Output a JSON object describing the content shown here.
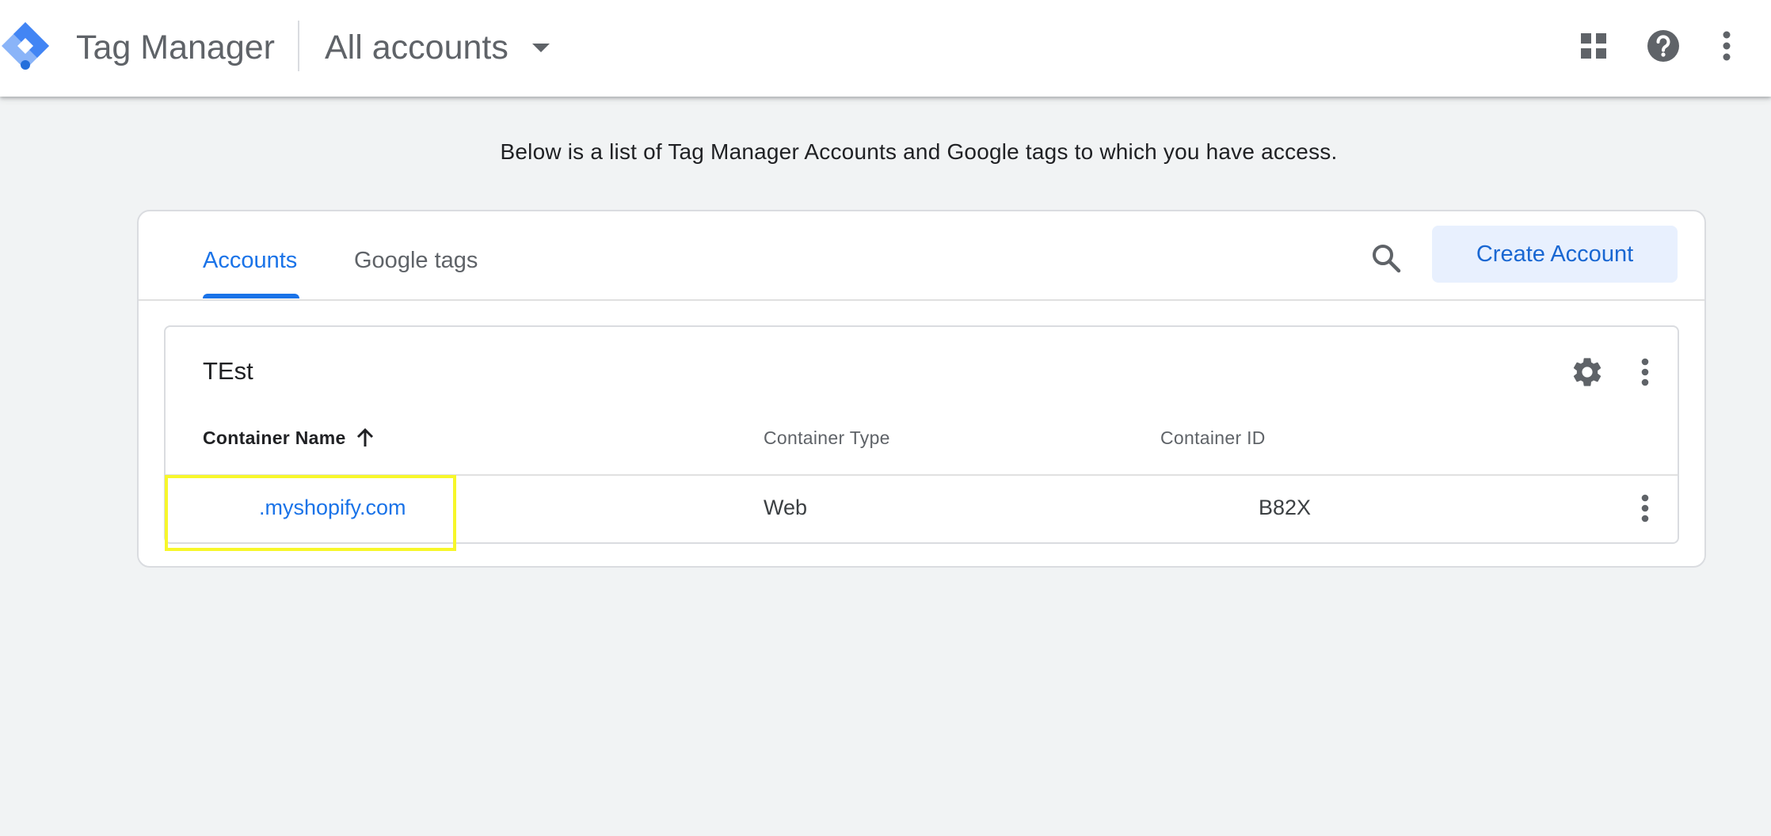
{
  "header": {
    "product_name": "Tag Manager",
    "account_switcher_label": "All accounts",
    "icons": [
      "tag-manager-logo",
      "apps-icon",
      "help-icon",
      "more-vert-icon"
    ]
  },
  "intro_text": "Below is a list of Tag Manager Accounts and Google tags to which you have access.",
  "tabs": [
    {
      "label": "Accounts",
      "active": true
    },
    {
      "label": "Google tags",
      "active": false
    }
  ],
  "toolbar": {
    "create_label": "Create Account"
  },
  "account": {
    "name": "TEst",
    "columns": [
      "Container Name",
      "Container Type",
      "Container ID"
    ],
    "sort": {
      "column": "Container Name",
      "direction": "ascending"
    },
    "rows": [
      {
        "name": ".myshopify.com",
        "type": "Web",
        "id": "B82X"
      }
    ]
  },
  "colors": {
    "accent": "#1a73e8",
    "button_bg": "#e8f0fe",
    "highlight": "#f7f72a",
    "page_bg": "#f1f3f4"
  }
}
